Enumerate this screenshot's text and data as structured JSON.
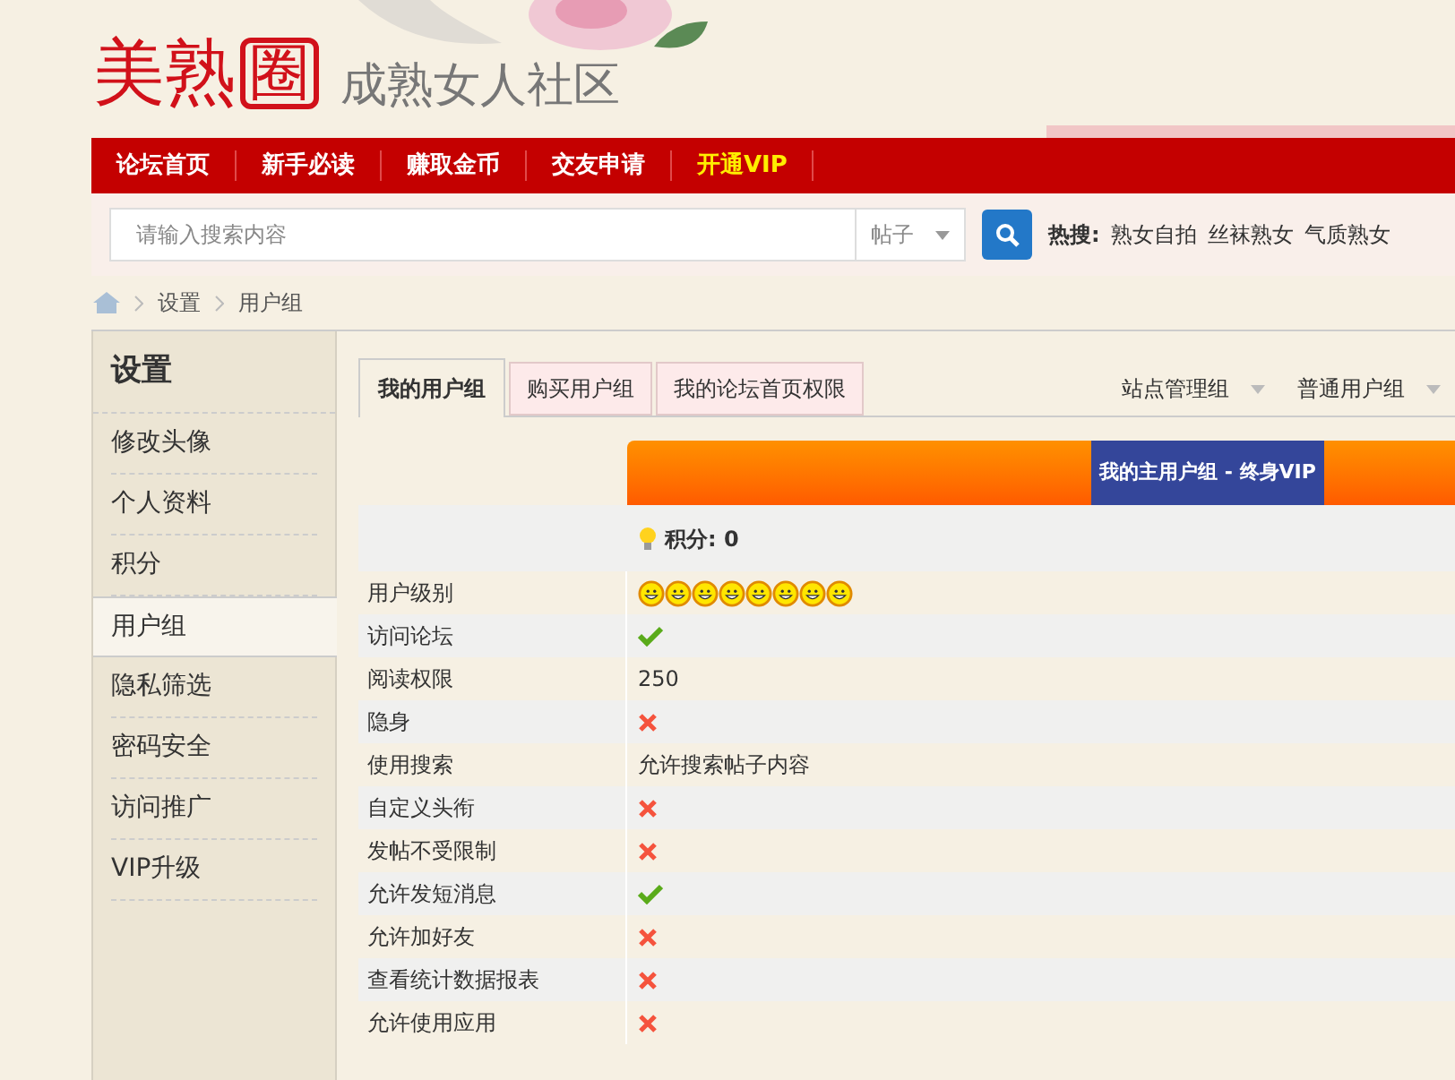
{
  "logo": {
    "name": "美熟",
    "name_boxed": "圈",
    "tagline": "成熟女人社区"
  },
  "nav": [
    {
      "label": "论坛首页",
      "highlight": false
    },
    {
      "label": "新手必读",
      "highlight": false
    },
    {
      "label": "赚取金币",
      "highlight": false
    },
    {
      "label": "交友申请",
      "highlight": false
    },
    {
      "label": "开通VIP",
      "highlight": true
    }
  ],
  "search": {
    "placeholder": "请输入搜索内容",
    "scope": "帖子",
    "hot_label": "热搜:",
    "hot": [
      "熟女自拍",
      "丝袜熟女",
      "气质熟女"
    ]
  },
  "breadcrumb": [
    "设置",
    "用户组"
  ],
  "sidebar": {
    "title": "设置",
    "items": [
      {
        "label": "修改头像",
        "selected": false
      },
      {
        "label": "个人资料",
        "selected": false
      },
      {
        "label": "积分",
        "selected": false
      },
      {
        "label": "用户组",
        "selected": true
      },
      {
        "label": "隐私筛选",
        "selected": false
      },
      {
        "label": "密码安全",
        "selected": false
      },
      {
        "label": "访问推广",
        "selected": false
      },
      {
        "label": "VIP升级",
        "selected": false
      }
    ]
  },
  "tabs": [
    {
      "label": "我的用户组",
      "selected": true
    },
    {
      "label": "购买用户组",
      "selected": false
    },
    {
      "label": "我的论坛首页权限",
      "selected": false
    }
  ],
  "group_menus": [
    "站点管理组",
    "普通用户组"
  ],
  "group_header": "我的主用户组 - 终身VIP",
  "points": "积分: 0",
  "rows": [
    {
      "label": "用户级别",
      "kind": "rank",
      "stars": 8
    },
    {
      "label": "访问论坛",
      "kind": "yes"
    },
    {
      "label": "阅读权限",
      "kind": "text",
      "value": "250"
    },
    {
      "label": "隐身",
      "kind": "no"
    },
    {
      "label": "使用搜索",
      "kind": "text",
      "value": "允许搜索帖子内容"
    },
    {
      "label": "自定义头衔",
      "kind": "no"
    },
    {
      "label": "发帖不受限制",
      "kind": "no"
    },
    {
      "label": "允许发短消息",
      "kind": "yes"
    },
    {
      "label": "允许加好友",
      "kind": "no"
    },
    {
      "label": "查看统计数据报表",
      "kind": "no"
    },
    {
      "label": "允许使用应用",
      "kind": "no"
    }
  ]
}
